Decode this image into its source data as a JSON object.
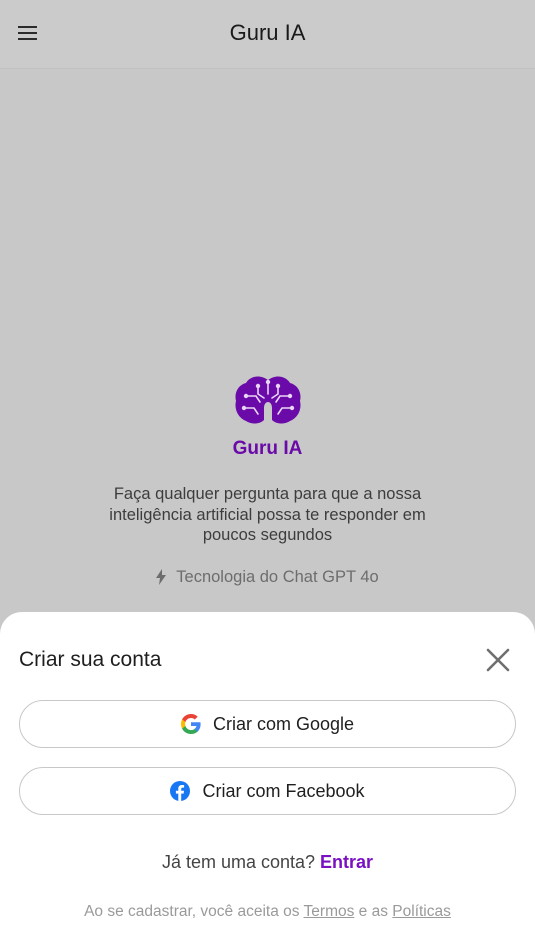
{
  "header": {
    "title": "Guru IA",
    "menu_icon": "hamburger-menu-icon"
  },
  "hero": {
    "logo_icon": "brain-circuit-logo",
    "name": "Guru IA",
    "description": "Faça qualquer pergunta para que a nossa inteligência artificial possa te responder em poucos segundos",
    "tech_icon": "lightning-bolt-icon",
    "tech_label": "Tecnologia do Chat GPT 4o"
  },
  "sheet": {
    "title": "Criar sua conta",
    "close_icon": "close-icon",
    "google_label": "Criar com Google",
    "facebook_label": "Criar com Facebook",
    "login_prompt": "Já tem uma conta?",
    "login_link": "Entrar",
    "terms_prefix": "Ao se cadastrar, você aceita os",
    "terms_link": "Termos",
    "terms_middle": "e as",
    "policies_link": "Políticas"
  },
  "colors": {
    "accent": "#6a0aa8",
    "backdrop": "#c8c8c8",
    "sheet_bg": "#ffffff",
    "facebook_blue": "#1877f2"
  }
}
